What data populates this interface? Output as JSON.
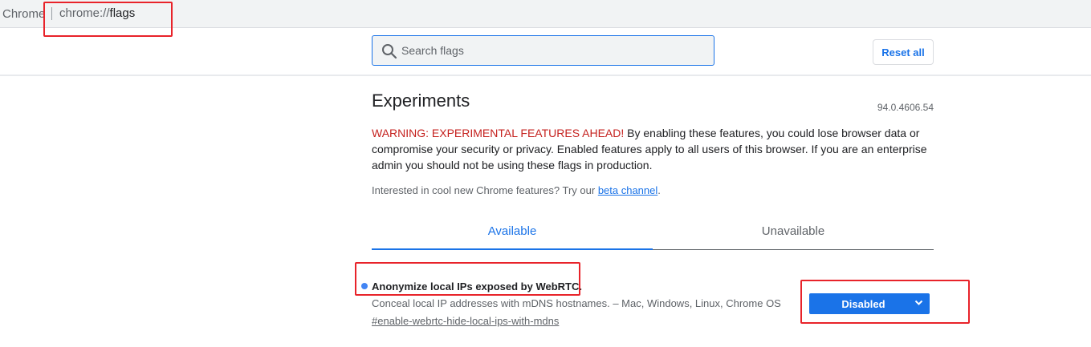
{
  "omnibox": {
    "chip": "Chrome",
    "url_scheme": "chrome://",
    "url_path": "flags"
  },
  "search": {
    "placeholder": "Search flags",
    "value": ""
  },
  "reset_label": "Reset all",
  "title": "Experiments",
  "version": "94.0.4606.54",
  "warning": {
    "highlight": "WARNING: EXPERIMENTAL FEATURES AHEAD!",
    "text": " By enabling these features, you could lose browser data or compromise your security or privacy. Enabled features apply to all users of this browser. If you are an enterprise admin you should not be using these flags in production."
  },
  "interested": {
    "prefix": "Interested in cool new Chrome features? Try our ",
    "link": "beta channel",
    "suffix": "."
  },
  "tabs": [
    {
      "label": "Available",
      "selected": true
    },
    {
      "label": "Unavailable",
      "selected": false
    }
  ],
  "flag": {
    "name": "Anonymize local IPs exposed by WebRTC.",
    "description": "Conceal local IP addresses with mDNS hostnames. – Mac, Windows, Linux, Chrome OS",
    "link": "#enable-webrtc-hide-local-ips-with-mdns",
    "selected_option": "Disabled"
  },
  "colors": {
    "accent": "#1a73e8",
    "warning": "#c5221f",
    "annotation": "#e8232a",
    "modified_dot": "#4285f4"
  },
  "icons": [
    "search-icon",
    "chevron-down-icon"
  ]
}
